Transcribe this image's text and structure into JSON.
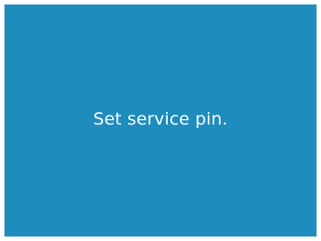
{
  "screen": {
    "message": "Set service pin.",
    "background_color": "#1e8cbc",
    "text_color": "#ffffff"
  }
}
